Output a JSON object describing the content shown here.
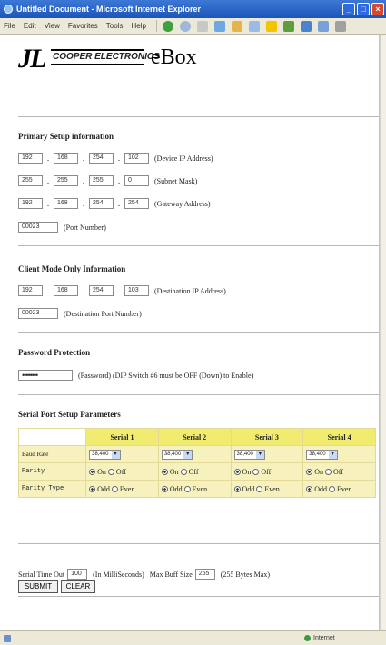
{
  "window": {
    "title": "Untitled Document - Microsoft Internet Explorer",
    "menus": [
      "File",
      "Edit",
      "View",
      "Favorites",
      "Tools",
      "Help"
    ]
  },
  "logo": {
    "initials": "JL",
    "brand": "COOPER ELECTRONICS",
    "product": "eBox"
  },
  "primary": {
    "heading": "Primary Setup information",
    "device_ip": [
      "192",
      "168",
      "254",
      "102"
    ],
    "device_ip_label": "(Device IP Address)",
    "subnet": [
      "255",
      "255",
      "255",
      "0"
    ],
    "subnet_label": "(Subnet Mask)",
    "gateway": [
      "192",
      "168",
      "254",
      "254"
    ],
    "gateway_label": "(Gateway Address)",
    "port": "00023",
    "port_label": "(Port Number)"
  },
  "client": {
    "heading": "Client Mode Only Information",
    "dest_ip": [
      "192",
      "168",
      "254",
      "103"
    ],
    "dest_ip_label": "(Destination IP Address)",
    "dest_port": "00023",
    "dest_port_label": "(Destination Port Number)"
  },
  "password": {
    "heading": "Password Protection",
    "value": "••••••••",
    "label": "(Password) (DIP Switch #6 must be OFF (Down) to Enable)"
  },
  "serial": {
    "heading": "Serial Port Setup Parameters",
    "columns": [
      "Serial 1",
      "Serial 2",
      "Serial 3",
      "Serial 4"
    ],
    "rows": {
      "baud_label": "Baud Rate",
      "baud": [
        "38,400",
        "38,400",
        "38,400",
        "38,400"
      ],
      "parity_label": "Parity",
      "on": "On",
      "off": "Off",
      "parity_type_label": "Parity Type",
      "odd": "Odd",
      "even": "Even"
    }
  },
  "timeout": {
    "label": "Serial Time Out",
    "value": "100",
    "unit": "(In MilliSeconds)",
    "buff_label": "Max Buff Size",
    "buff_value": "255",
    "buff_note": "(255 Bytes Max)"
  },
  "buttons": {
    "submit": "SUBMIT",
    "clear": "CLEAR"
  },
  "status": {
    "zone": "Internet"
  },
  "colors": {
    "header": "#f1ec6f",
    "cell": "#f7f1bd",
    "titlebar": "#1b55b8"
  }
}
